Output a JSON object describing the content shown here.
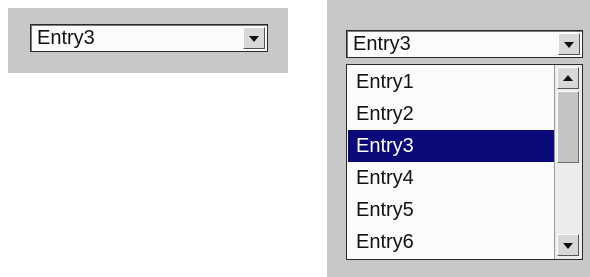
{
  "closed_combo": {
    "value": "Entry3",
    "arrow_icon": "chevron-down-icon"
  },
  "open_combo": {
    "value": "Entry3",
    "arrow_icon": "chevron-down-icon",
    "items": [
      "Entry1",
      "Entry2",
      "Entry3",
      "Entry4",
      "Entry5",
      "Entry6"
    ],
    "selected_item": "Entry3",
    "scroll_position": 0.0
  },
  "colors": {
    "panel_background": "#c8c8c8",
    "selection_background": "#0a0a7a",
    "selection_text": "#ffffff"
  }
}
